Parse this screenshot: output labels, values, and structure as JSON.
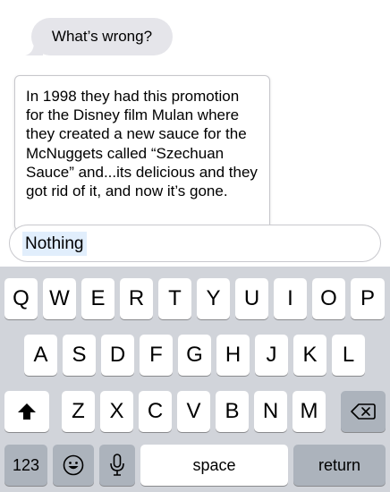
{
  "conversation": {
    "incoming_message": "What’s wrong?",
    "popover_text": "In 1998 they had this promotion for the Disney film Mulan where they created a new sauce for the McNuggets called “Szechuan Sauce” and...its delicious and they got rid of it, and now it’s gone."
  },
  "input": {
    "value": "Nothing"
  },
  "keyboard": {
    "row1": [
      "Q",
      "W",
      "E",
      "R",
      "T",
      "Y",
      "U",
      "I",
      "O",
      "P"
    ],
    "row2": [
      "A",
      "S",
      "D",
      "F",
      "G",
      "H",
      "J",
      "K",
      "L"
    ],
    "row3": [
      "Z",
      "X",
      "C",
      "V",
      "B",
      "N",
      "M"
    ],
    "numbers_label": "123",
    "space_label": "space",
    "return_label": "return",
    "icons": {
      "shift": "shift-arrow-icon",
      "delete": "backspace-icon",
      "emoji": "emoji-icon",
      "dictation": "microphone-icon"
    }
  },
  "colors": {
    "incoming_bubble": "#e5e5ea",
    "keyboard_background": "#d1d4da",
    "function_key": "#acb3bc",
    "letter_key": "#ffffff",
    "text_selection": "#e1eefc"
  }
}
